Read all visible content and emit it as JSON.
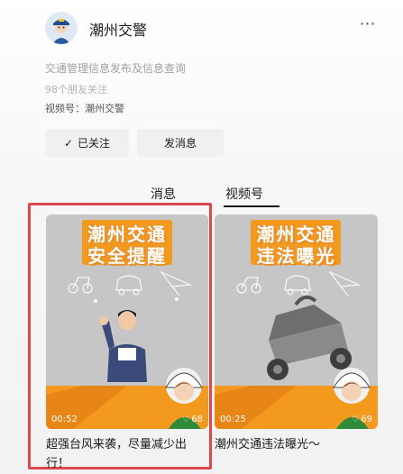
{
  "account": {
    "name": "潮州交警",
    "description": "交通管理信息发布及信息查询",
    "followers": "98个朋友关注",
    "channel": "视频号：潮州交警"
  },
  "actions": {
    "follow_label": "已关注",
    "message_label": "发消息"
  },
  "tabs": [
    {
      "label": "消息",
      "active": false
    },
    {
      "label": "视频号",
      "active": true
    }
  ],
  "videos": [
    {
      "banner_line1": "潮州交通",
      "banner_line2": "安全提醒",
      "duration": "00:52",
      "likes": "68",
      "caption": "超强台风来袭，尽量减少出行！",
      "highlighted": true
    },
    {
      "banner_line1": "潮州交通",
      "banner_line2": "违法曝光",
      "duration": "00:25",
      "likes": "69",
      "caption": "潮州交通违法曝光～",
      "highlighted": false
    }
  ],
  "colors": {
    "banner_orange": "#f39a1e",
    "highlight_red": "#e0464e",
    "card_gray": "#c6c6c6"
  },
  "icons": [
    "avatar-police-icon",
    "more-dots-icon",
    "check-icon",
    "like-icon"
  ]
}
